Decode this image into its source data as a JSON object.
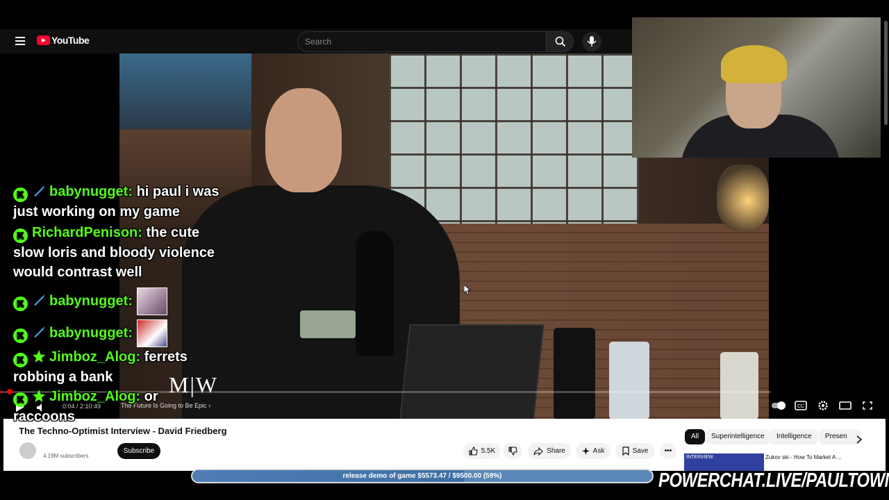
{
  "youtube": {
    "logo": "YouTube",
    "search_placeholder": "Search"
  },
  "video": {
    "watermark": "M|W",
    "current_time": "0:04 / 2:10:49",
    "chapter": "The Future Is Going to Be Epic",
    "title": "The Techno-Optimist Interview - David Friedberg",
    "subscribers": "4.19M subscribers",
    "subscribe_label": "Subscribe",
    "progress_fraction": 0.003
  },
  "actions": {
    "likes": "5.5K",
    "share": "Share",
    "ask": "Ask",
    "save": "Save"
  },
  "chips": [
    "All",
    "Superintelligence",
    "Intelligence",
    "Presen"
  ],
  "recommendation": {
    "thumb_text": "INTERVIEW",
    "title": "Zukov ski - How To Market A ..."
  },
  "chat": [
    {
      "user": "babynugget",
      "text": "hi paul i was just working on my game",
      "badges": [
        "kick",
        "sword"
      ]
    },
    {
      "user": "RichardPenison",
      "text": "the cute slow loris and bloody violence would contrast well",
      "badges": [
        "kick"
      ]
    },
    {
      "user": "babynugget",
      "text": "",
      "emote": true,
      "badges": [
        "kick",
        "sword"
      ]
    },
    {
      "user": "babynugget",
      "text": "",
      "emote": true,
      "badges": [
        "kick",
        "sword"
      ]
    },
    {
      "user": "Jimboz_Alog",
      "text": "ferrets robbing a bank",
      "badges": [
        "kick",
        "star"
      ]
    },
    {
      "user": "Jimboz_Alog",
      "text": "or raccoons",
      "badges": [
        "kick",
        "star"
      ]
    }
  ],
  "goal": {
    "text": "release demo of game $5573.47 / $9500.00 (59%)",
    "fraction": 0.59
  },
  "promo": "POWERCHAT.LIVE/PAULTOWN",
  "colors": {
    "kick_green": "#53fc18",
    "youtube_red": "#ff0033",
    "goal_blue": "#4e7eb4"
  }
}
